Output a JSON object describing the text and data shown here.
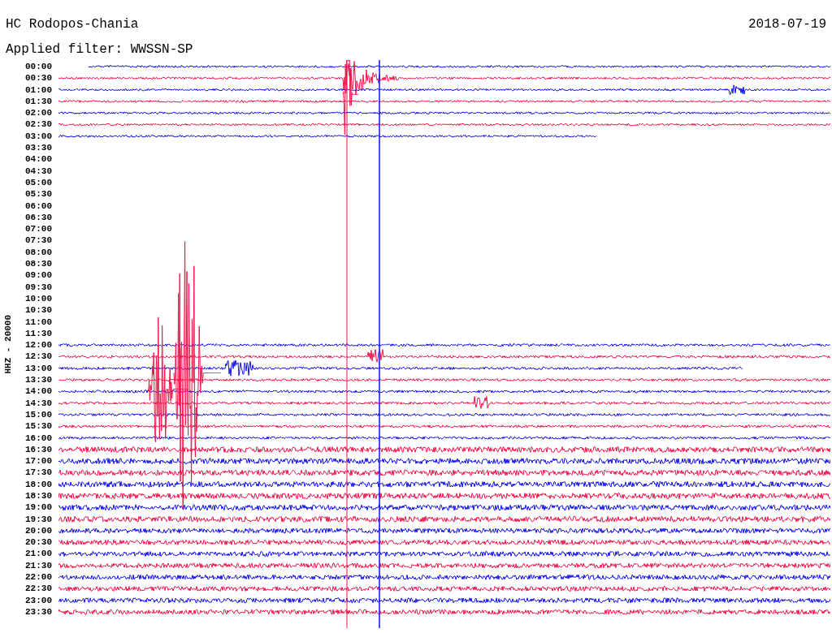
{
  "header": {
    "station": "HC Rodopos-Chania",
    "filter": "Applied filter: WWSSN-SP",
    "date": "2018-07-19"
  },
  "channel_label": "HHZ - 20000",
  "rows": [
    {
      "time": "00:00",
      "color": "#1010f0"
    },
    {
      "time": "00:30",
      "color": "#f0144a"
    },
    {
      "time": "01:00",
      "color": "#1010f0"
    },
    {
      "time": "01:30",
      "color": "#f0144a"
    },
    {
      "time": "02:00",
      "color": "#1010f0"
    },
    {
      "time": "02:30",
      "color": "#f0144a"
    },
    {
      "time": "03:00",
      "color": "#1010f0"
    },
    {
      "time": "03:30"
    },
    {
      "time": "04:00"
    },
    {
      "time": "04:30"
    },
    {
      "time": "05:00"
    },
    {
      "time": "05:30"
    },
    {
      "time": "06:00"
    },
    {
      "time": "06:30"
    },
    {
      "time": "07:00"
    },
    {
      "time": "07:30"
    },
    {
      "time": "08:00"
    },
    {
      "time": "08:30"
    },
    {
      "time": "09:00"
    },
    {
      "time": "09:30"
    },
    {
      "time": "10:00"
    },
    {
      "time": "10:30"
    },
    {
      "time": "11:00"
    },
    {
      "time": "11:30"
    },
    {
      "time": "12:00",
      "color": "#1010f0"
    },
    {
      "time": "12:30",
      "color": "#f0144a"
    },
    {
      "time": "13:00",
      "color": "#1010f0"
    },
    {
      "time": "13:30",
      "color": "#f0144a"
    },
    {
      "time": "14:00",
      "color": "#1010f0"
    },
    {
      "time": "14:30",
      "color": "#f0144a"
    },
    {
      "time": "15:00",
      "color": "#1010f0"
    },
    {
      "time": "15:30",
      "color": "#f0144a"
    },
    {
      "time": "16:00",
      "color": "#1010f0"
    },
    {
      "time": "16:30",
      "color": "#f0144a"
    },
    {
      "time": "17:00",
      "color": "#1010f0"
    },
    {
      "time": "17:30",
      "color": "#f0144a"
    },
    {
      "time": "18:00",
      "color": "#1010f0"
    },
    {
      "time": "18:30",
      "color": "#f0144a"
    },
    {
      "time": "19:00",
      "color": "#1010f0"
    },
    {
      "time": "19:30",
      "color": "#f0144a"
    },
    {
      "time": "20:00",
      "color": "#1010f0"
    },
    {
      "time": "20:30",
      "color": "#f0144a"
    },
    {
      "time": "21:00",
      "color": "#1010f0"
    },
    {
      "time": "21:30",
      "color": "#f0144a"
    },
    {
      "time": "22:00",
      "color": "#1010f0"
    },
    {
      "time": "22:30",
      "color": "#f0144a"
    },
    {
      "time": "23:00",
      "color": "#1010f0"
    },
    {
      "time": "23:30",
      "color": "#f0144a"
    }
  ]
}
